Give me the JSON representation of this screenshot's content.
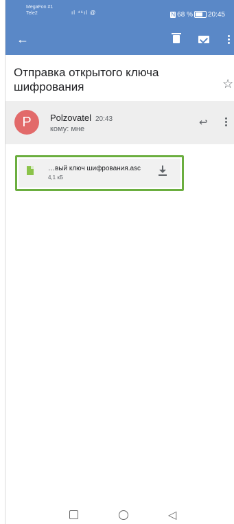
{
  "status_bar": {
    "carrier1": "MegaFon #1",
    "carrier2": "Tele2",
    "signal": "ıl ⁴⁶ıl @",
    "nfc": "N",
    "battery": "68 %",
    "time": "20:45"
  },
  "app_bar": {
    "back_icon": "arrow-left-icon",
    "actions": [
      "trash-icon",
      "mark-unread-icon",
      "more-vert-icon"
    ]
  },
  "message": {
    "subject": "Отправка открытого ключа шифрования",
    "sender_initial": "P",
    "sender_name": "Polzovatel",
    "sent_time": "20:43",
    "recipient": "кому: мне"
  },
  "attachment": {
    "name": "…вый ключ шифрования.asc",
    "size": "4,1 кБ"
  },
  "colors": {
    "app_bar": "#5a88c7",
    "avatar": "#e26a6a",
    "file_icon": "#8bc34a",
    "highlight_border": "#6bae3f"
  }
}
